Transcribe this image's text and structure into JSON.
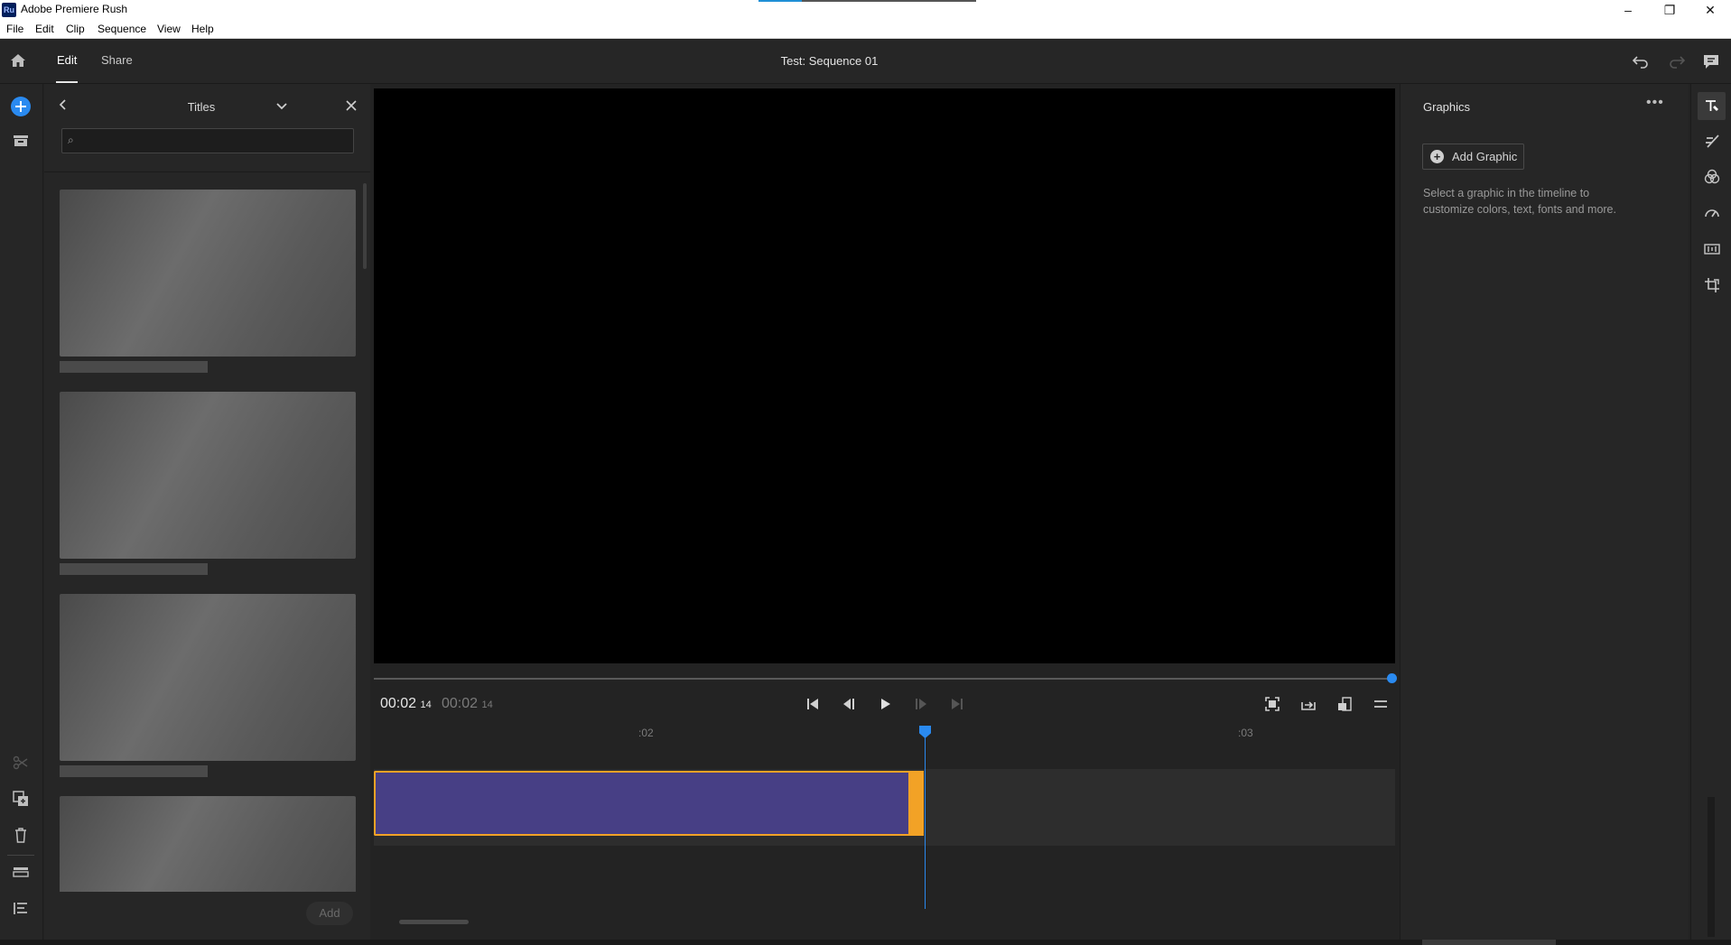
{
  "window": {
    "app_icon": "Ru",
    "title": "Adobe Premiere Rush",
    "controls": {
      "minimize": "–",
      "maximize": "❐",
      "close": "✕"
    }
  },
  "menu": [
    "File",
    "Edit",
    "Clip",
    "Sequence",
    "View",
    "Help"
  ],
  "header": {
    "tabs": [
      {
        "label": "Edit",
        "active": true
      },
      {
        "label": "Share",
        "active": false
      }
    ],
    "sequence_title": "Test: Sequence 01"
  },
  "titles_panel": {
    "title": "Titles",
    "search": {
      "value": "",
      "placeholder": ""
    },
    "add_label": "Add"
  },
  "player": {
    "current_time": "00:02",
    "current_frames": "14",
    "duration_time": "00:02",
    "duration_frames": "14",
    "scrub_position": 1.0
  },
  "timeline": {
    "ruler_marks": [
      ":02",
      ":03"
    ]
  },
  "graphics_panel": {
    "title": "Graphics",
    "add_graphic_label": "Add Graphic",
    "hint": "Select a graphic in the timeline to customize colors, text, fonts and more."
  },
  "colors": {
    "accent_blue": "#2a8af0",
    "clip_fill": "#473f85",
    "clip_border": "#f2a226"
  }
}
